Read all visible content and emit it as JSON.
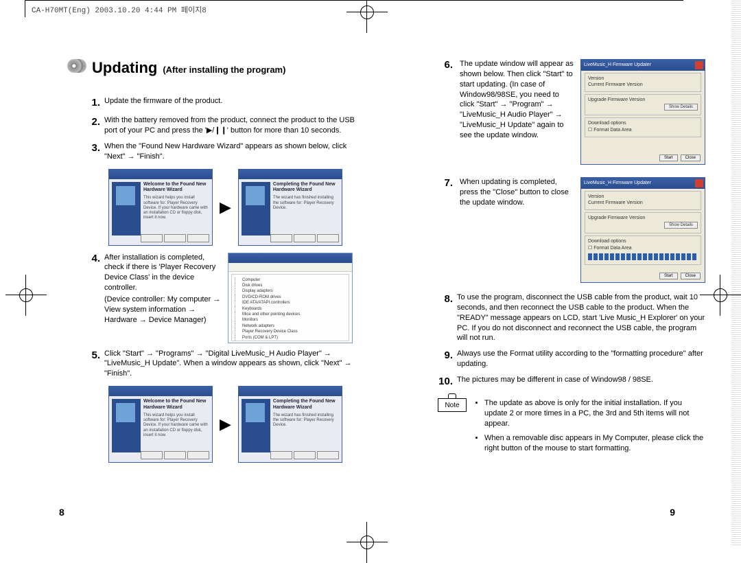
{
  "meta": {
    "header": "CA-H70MT(Eng)  2003.10.20  4:44 PM  페이지8"
  },
  "title": {
    "main": "Updating",
    "sub": "(After installing the program)"
  },
  "steps_left": {
    "s1": "Update the firmware of the product.",
    "s2": "With the battery removed from the product, connect the product to the USB port of your PC and press the '▶/❙❙' button for more than 10 seconds.",
    "s3": "When the \"Found New Hardware Wizard\" appears as shown below, click \"Next\" → \"Finish\".",
    "s4_a": "After installation is completed, check if there is 'Player Recovery Device Class' in the device controller.",
    "s4_b": "(Device controller: My computer → View system information → Hardware → Device Manager)",
    "s5": "Click \"Start\" → \"Programs\" → \"Digital LiveMusic_H Audio Player\" → \"LiveMusic_H Update\".  When a window appears as shown, click \"Next\" → \"Finish\"."
  },
  "wizard": {
    "left_h": "Welcome to the Found New Hardware Wizard",
    "left_t": "This wizard helps you install software for: Player Recovery Device. If your hardware came with an installation CD or floppy disk, insert it now.",
    "right_h": "Completing the Found New Hardware Wizard",
    "right_t": "The wizard has finished installing the software for: Player Recovery Device."
  },
  "steps_right": {
    "s6": "The update window will appear as shown below.  Then click \"Start\" to start updating. (In case of Window98/98SE, you need to click \"Start\" → \"Program\" → \"LiveMusic_H Audio Player\" → \"LiveMusic_H Update\" again to see the update window.",
    "s7": "When updating is completed, press the \"Close\" button to close the update window.",
    "s8": "To use the program, disconnect the USB cable from the product, wait 10 seconds, and then reconnect the USB cable to the product.  When the \"READY\" message appears on LCD, start 'Live Music_H Explorer' on your PC.  If you do not disconnect and reconnect the USB cable, the program will not run.",
    "s9": "Always use the Format utility according to the \"formatting procedure\" after updating.",
    "s10": "The pictures may be different in case of Window98 / 98SE."
  },
  "updater": {
    "title": "LiveMusic_H Firmware Updater",
    "g1": "Current Firmware Version",
    "g2": "Upgrade Firmware Version",
    "show": "Show Details",
    "g3": "Download options",
    "opt": "Format Data Area",
    "start": "Start",
    "close": "Close"
  },
  "note": {
    "label": "Note",
    "n1": "The update as above is only for the initial installation. If you update 2 or more times in a PC, the 3rd and 5th items will not appear.",
    "n2": "When a removable disc appears in My Computer, please click the right button of the mouse to start formatting."
  },
  "page_left": "8",
  "page_right": "9"
}
